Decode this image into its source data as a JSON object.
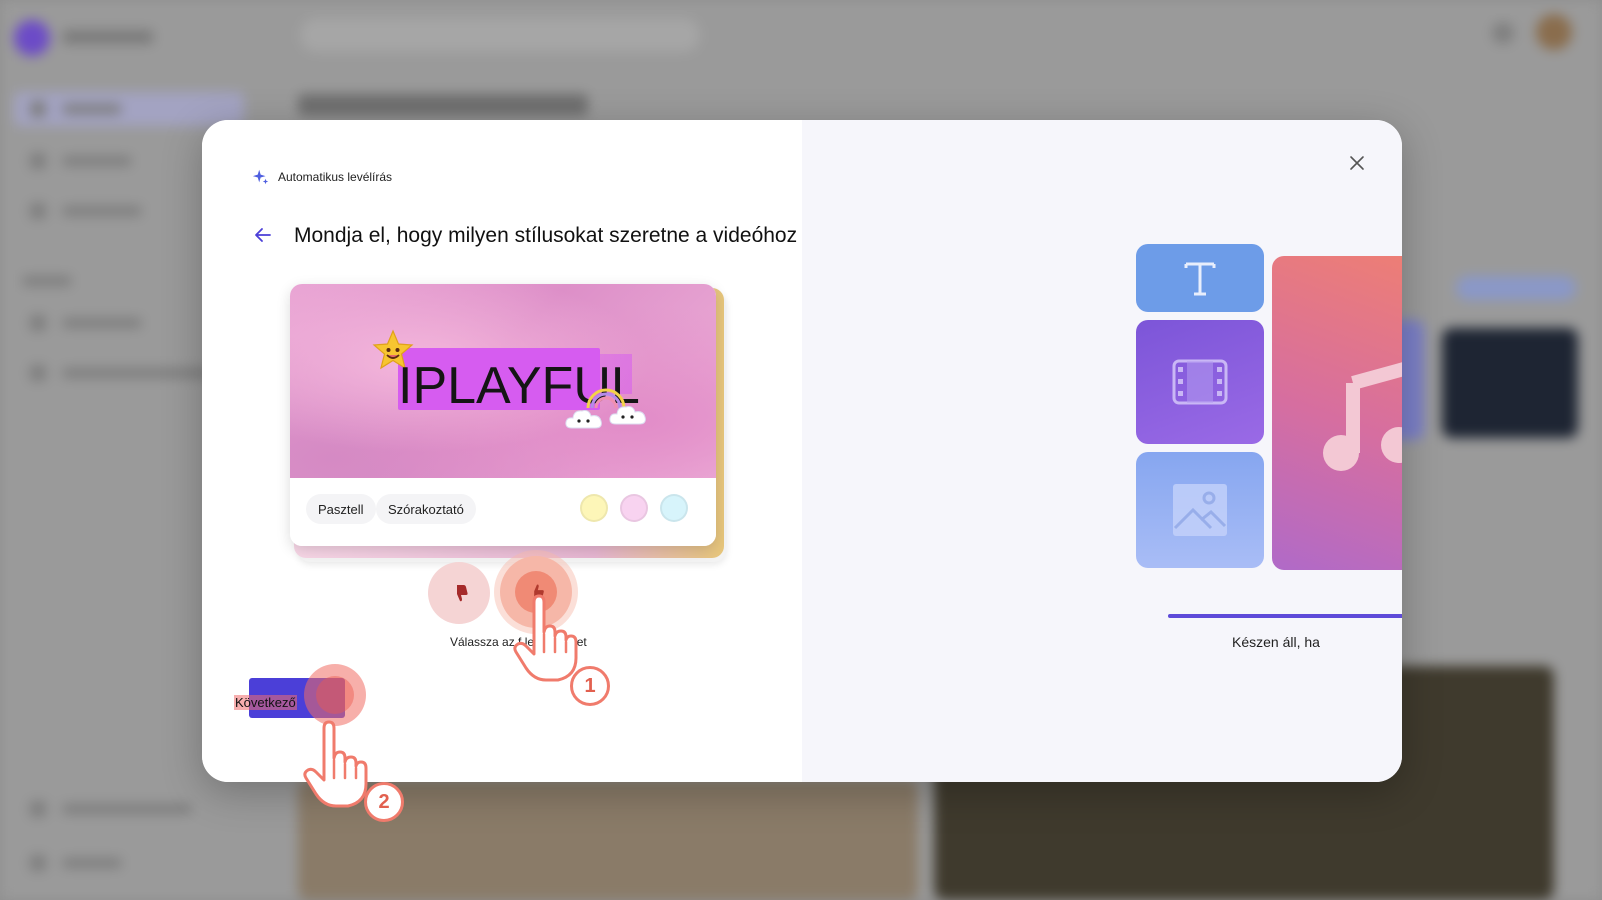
{
  "dialog": {
    "brand_label": "Automatikus levélírás",
    "title": "Mondja el, hogy milyen stílusokat szeretne a videóhoz",
    "close_icon": "close-icon",
    "back_icon": "arrow-left-icon"
  },
  "style_card": {
    "preview_text": "IPLAYFUL",
    "tags": [
      "Pasztell",
      "Szórakoztató"
    ],
    "swatches": [
      "#fdf6b8",
      "#f8d3f0",
      "#d7f4fb"
    ]
  },
  "feedback": {
    "dislike_icon": "thumbs-down-icon",
    "like_icon": "thumbs-up-icon",
    "hint": "Válassza az f lehetőséget"
  },
  "actions": {
    "next_label": "Következő"
  },
  "preview_panel": {
    "tiles": [
      "text-icon",
      "film-icon",
      "image-icon",
      "music-note-icon"
    ],
    "status": "Készen áll, ha"
  },
  "tutorial": {
    "step1": "1",
    "step2": "2"
  },
  "colors": {
    "accent": "#4b3fd8",
    "highlight": "#f07b6c"
  }
}
